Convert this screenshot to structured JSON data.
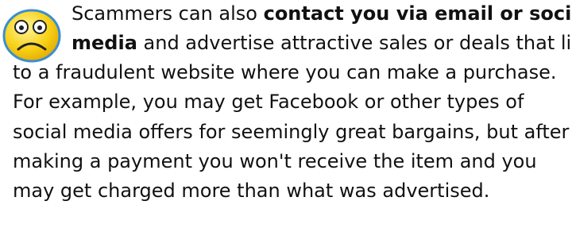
{
  "paragraph": {
    "line1_a": "Scammers can also ",
    "line1_b": "contact you via email or social",
    "line2_a": "media",
    "line2_b": " and advertise attractive sales or deals that link",
    "line3": "to a fraudulent website where you can make a purchase.",
    "line4": "For example, you may get Facebook or other types of",
    "line5": "social media offers for seemingly great bargains, but after",
    "line6": "making a  payment you won't receive the item and you",
    "line7": "may get charged more than what was advertised."
  },
  "icon": {
    "name": "worried-face-icon",
    "face_color": "#f7d117",
    "outline_color": "#3a8fd0"
  }
}
